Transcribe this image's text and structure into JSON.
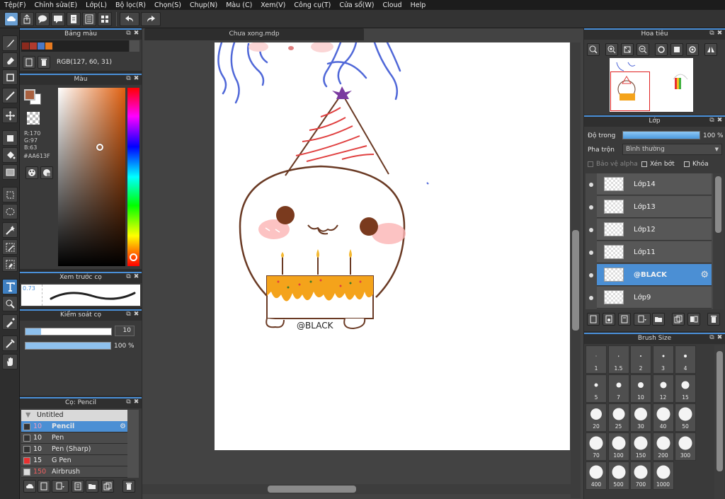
{
  "menu": [
    "Tệp(F)",
    "Chỉnh sửa(E)",
    "Lớp(L)",
    "Bộ lọc(R)",
    "Chọn(S)",
    "Chụp(N)",
    "Màu (C)",
    "Xem(V)",
    "Công cụ(T)",
    "Cửa sổ(W)",
    "Cloud",
    "Help"
  ],
  "document": {
    "tab_title": "Chưa xong.mdp"
  },
  "panels": {
    "palette": {
      "title": "Bảng màu",
      "rgb_text": "RGB(127, 60, 31)",
      "swatches": [
        "#8b2a1e",
        "#b03a2e",
        "#4a78c6",
        "#e77a20"
      ]
    },
    "color": {
      "title": "Màu",
      "r": "R:170",
      "g": "G:97",
      "b": "B:63",
      "hex": "#AA613F",
      "primary": "#aa613f"
    },
    "brush_preview": {
      "title": "Xem trước cọ",
      "size": "0.73"
    },
    "brush_control": {
      "title": "Kiểm soát cọ",
      "size_value": "10",
      "opacity_value": "100 %"
    },
    "brush": {
      "title": "Cọ: Pencil",
      "group": "Untitled",
      "items": [
        {
          "size": "10",
          "name": "Pencil",
          "color": "#333333",
          "selected": true
        },
        {
          "size": "10",
          "name": "Pen",
          "color": "#333333",
          "selected": false
        },
        {
          "size": "10",
          "name": "Pen (Sharp)",
          "color": "#333333",
          "selected": false
        },
        {
          "size": "15",
          "name": "G Pen",
          "color": "#e83030",
          "selected": false
        },
        {
          "size": "150",
          "name": "Airbrush",
          "color": "#dddddd",
          "selected": false
        }
      ]
    },
    "navigator": {
      "title": "Hoa tiêu"
    },
    "layers": {
      "title": "Lớp",
      "opacity_label": "Độ trong",
      "opacity_value": "100 %",
      "opacity_fraction": 1.0,
      "blend_label": "Pha trộn",
      "blend_value": "Bình thường",
      "protect_alpha": "Bảo vệ alpha",
      "clipping": "Xén bớt",
      "lock": "Khóa",
      "items": [
        "Lớp14",
        "Lớp13",
        "Lớp12",
        "Lớp11",
        "@BLACK",
        "Lớp9"
      ],
      "selected_index": 4
    },
    "brush_size": {
      "title": "Brush Size",
      "sizes": [
        "1",
        "1.5",
        "2",
        "3",
        "4",
        "5",
        "7",
        "10",
        "12",
        "15",
        "20",
        "25",
        "30",
        "40",
        "50",
        "70",
        "100",
        "150",
        "200",
        "300",
        "400",
        "500",
        "700",
        "1000"
      ]
    }
  },
  "canvas_text": "@BLACK",
  "colors": {
    "accent": "#4b8fd4",
    "panel": "#3a3a3a",
    "dark": "#2b2b2b",
    "hair": "#5068d8",
    "outline": "#6a3a24",
    "cake": "#f4a31b",
    "blush": "#f48a8a",
    "hat_stripe": "#e04040"
  }
}
